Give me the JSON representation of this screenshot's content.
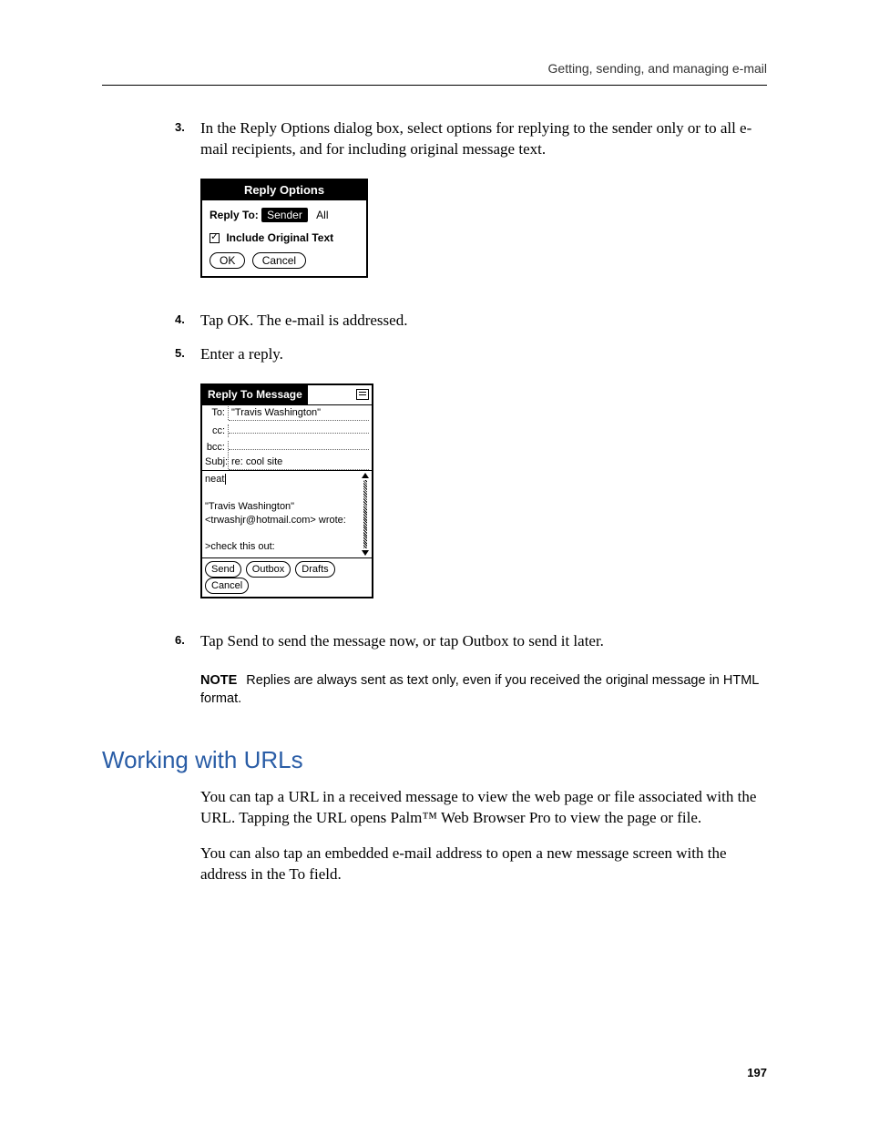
{
  "runhead": "Getting, sending, and managing e-mail",
  "steps": {
    "s3": {
      "num": "3.",
      "text": "In the Reply Options dialog box, select options for replying to the sender only or to all e-mail recipients, and for including original message text."
    },
    "s4": {
      "num": "4.",
      "text": "Tap OK. The e-mail is addressed."
    },
    "s5": {
      "num": "5.",
      "text": "Enter a reply."
    },
    "s6": {
      "num": "6.",
      "text": "Tap Send to send the message now, or tap Outbox to send it later."
    }
  },
  "fig1": {
    "title": "Reply Options",
    "replyto_label": "Reply To:",
    "seg_sender": "Sender",
    "seg_all": "All",
    "include_label": "Include Original Text",
    "ok": "OK",
    "cancel": "Cancel"
  },
  "fig2": {
    "title": "Reply To Message",
    "to_label": "To:",
    "to_value": "\"Travis Washington\"",
    "cc_label": "cc:",
    "bcc_label": "bcc:",
    "subj_label": "Subj:",
    "subj_value": "re: cool site",
    "body_line1": "neat",
    "body_line2": "\"Travis Washington\"",
    "body_line3": "<trwashjr@hotmail.com> wrote:",
    "body_line4": ">check this out:",
    "btn_send": "Send",
    "btn_outbox": "Outbox",
    "btn_drafts": "Drafts",
    "btn_cancel": "Cancel"
  },
  "note": {
    "label": "NOTE",
    "text": "Replies are always sent as text only, even if you received the original message in HTML format."
  },
  "section_title": "Working with URLs",
  "para1": "You can tap a URL in a received message to view the web page or file associated with the URL. Tapping the URL opens Palm™ Web Browser Pro to view the page or file.",
  "para2": "You can also tap an embedded e-mail address to open a new message screen with the address in the To field.",
  "page_number": "197"
}
